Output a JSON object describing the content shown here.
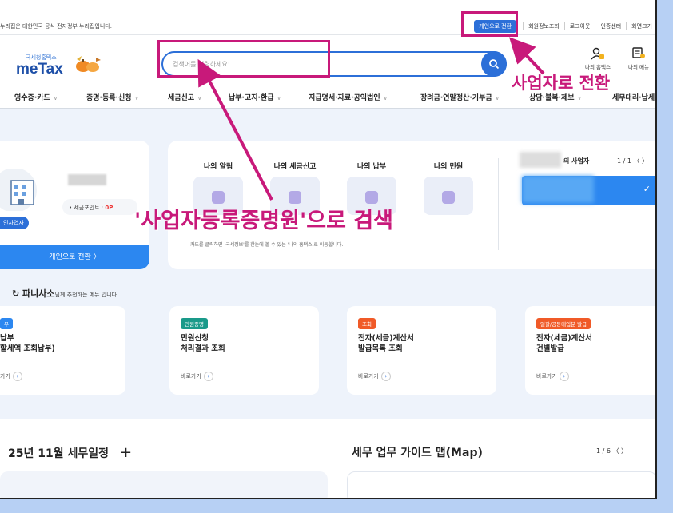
{
  "topbar": {
    "gov_notice": "누리집은 대한민국 공식 전자정부 누리집입니다.",
    "switch_button": "개인으로 전환",
    "links": [
      "회원정보조회",
      "로그아웃",
      "인증센터",
      "화면크기"
    ]
  },
  "header": {
    "logo_sub": "국세청홈택스",
    "logo_main": "meTax",
    "search_placeholder": "검색어를 입력하세요!",
    "my_hometax": "나의 홈택스",
    "my_menu": "나의 메뉴"
  },
  "nav": {
    "items": [
      "영수증·카드",
      "증명·등록·신청",
      "세금신고",
      "납부·고지·환급",
      "지급명세·자료·공익법인",
      "장려금·연말정산·기부금",
      "상담·불복·제보",
      "세무대리·납세"
    ]
  },
  "profile": {
    "biz_label": "인사업자",
    "points_label": "세금포인트 : ",
    "points_value": "0P",
    "switch_personal": "개인으로 전환 〉"
  },
  "my_panel": {
    "tabs": [
      "나의 알림",
      "나의 세금신고",
      "나의 납부",
      "나의 민원"
    ],
    "hint": "카드를 클릭하면 '국세정보'를 한눈에 볼 수 있는 '나의 홈택스'로 이동합니다.",
    "biz_title": "의 사업자",
    "pager": "1 / 1  〈  〉"
  },
  "recommend": {
    "name": "파니사소",
    "suffix": "님께 추천하는 메뉴 입니다.",
    "cards": [
      {
        "badge": "부",
        "badge_color": "#2c87f0",
        "name1": "납부",
        "name2": "할세액 조회납부)",
        "go": "가기"
      },
      {
        "badge": "민원증명",
        "badge_color": "#1a9a8a",
        "name1": "민원신청",
        "name2": "처리결과 조회",
        "go": "바로가기"
      },
      {
        "badge": "조회",
        "badge_color": "#f05a28",
        "name1": "전자(세금)계산서",
        "name2": "발급목록 조회",
        "go": "바로가기"
      },
      {
        "badge": "일괄/공동매입분 발급",
        "badge_color": "#f05a28",
        "name1": "전자(세금)계산서",
        "name2": "건별발급",
        "go": "바로가기"
      }
    ]
  },
  "bottom": {
    "schedule_title": "25년 11월 세무일정",
    "plus": "+",
    "guide_title": "세무 업무 가이드 맵(Map)",
    "guide_pager": "1 / 6  〈  〉"
  },
  "annotations": {
    "switch_text": "사업자로 전환",
    "search_text": "'사업자등록증명원'으로 검색",
    "color": "#c8197a"
  }
}
